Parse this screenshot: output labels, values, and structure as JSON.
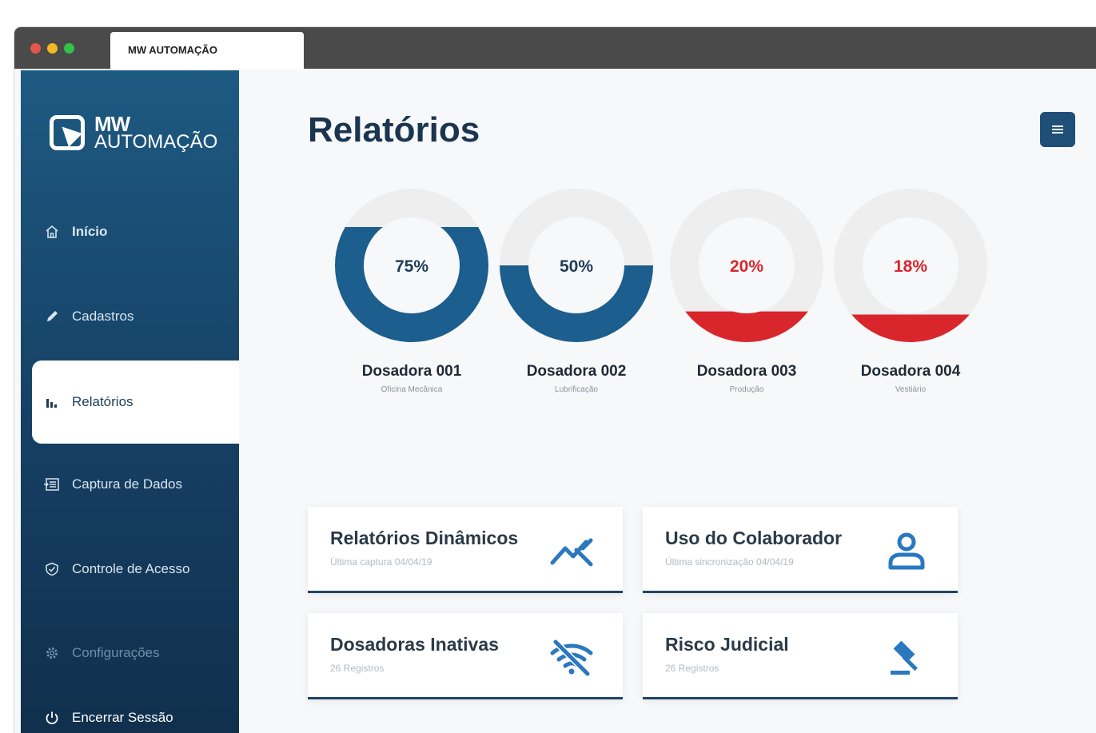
{
  "browser": {
    "tab_title": "MW AUTOMAÇÃO"
  },
  "logo": {
    "line1": "MW",
    "line2": "AUTOMAÇÃO"
  },
  "sidebar": {
    "items": [
      {
        "label": "Início",
        "icon": "home-icon"
      },
      {
        "label": "Cadastros",
        "icon": "pencil-icon"
      },
      {
        "label": "Relatórios",
        "icon": "bar-chart-icon"
      },
      {
        "label": "Captura de Dados",
        "icon": "data-capture-icon"
      },
      {
        "label": "Controle de Acesso",
        "icon": "shield-icon"
      },
      {
        "label": "Configurações",
        "icon": "gear-icon"
      },
      {
        "label": "Encerrar Sessão",
        "icon": "power-icon"
      }
    ]
  },
  "main": {
    "title": "Relatórios",
    "menu_icon": "hamburger-icon"
  },
  "gauges": [
    {
      "percent_label": "75%",
      "value": 0.75,
      "name": "Dosadora 001",
      "location": "Oficina Mecânica",
      "color": "#1c5e8e"
    },
    {
      "percent_label": "50%",
      "value": 0.5,
      "name": "Dosadora 002",
      "location": "Lubrificação",
      "color": "#1c5e8e"
    },
    {
      "percent_label": "20%",
      "value": 0.2,
      "name": "Dosadora 003",
      "location": "Produção",
      "color": "#d9262c"
    },
    {
      "percent_label": "18%",
      "value": 0.18,
      "name": "Dosadora 004",
      "location": "Vestiário",
      "color": "#d9262c"
    }
  ],
  "cards": [
    {
      "title": "Relatórios Dinâmicos",
      "subtitle": "Última captura 04/04/19",
      "icon": "trend-icon"
    },
    {
      "title": "Uso do Colaborador",
      "subtitle": "Última sincronização 04/04/19",
      "icon": "user-icon"
    },
    {
      "title": "Dosadoras Inativas",
      "subtitle": "26 Registros",
      "icon": "wifi-off-icon"
    },
    {
      "title": "Risco Judicial",
      "subtitle": "26 Registros",
      "icon": "gavel-icon"
    }
  ],
  "colors": {
    "brand_dark": "#163f63",
    "accent_blue": "#1c5e8e",
    "alert_red": "#d9262c",
    "gauge_track": "#eeeeee"
  }
}
